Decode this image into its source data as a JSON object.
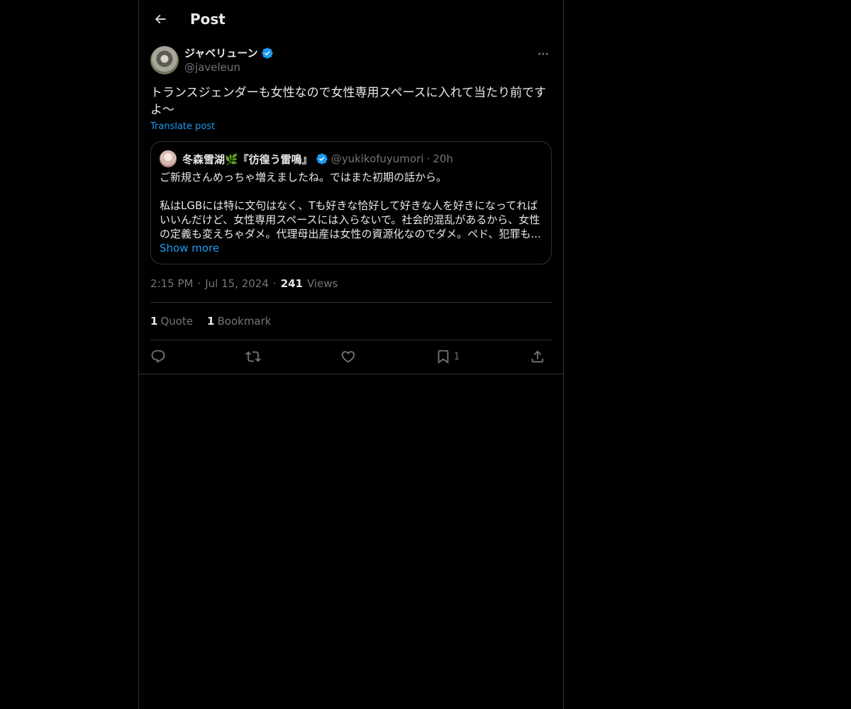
{
  "header": {
    "title": "Post"
  },
  "post": {
    "author_name": "ジャベリューン",
    "author_handle": "@javeleun",
    "verified": true,
    "text": "トランスジェンダーも女性なので女性専用スペースに入れて当たり前ですよ～",
    "translate_label": "Translate post",
    "time": "2:15 PM",
    "date": "Jul 15, 2024",
    "views_count": "241",
    "views_label": "Views",
    "separator": "·"
  },
  "quote": {
    "author_name": "冬森雪湖🌿『彷徨う雷鳴』",
    "author_handle": "@yukikofuyumori",
    "separator": "·",
    "time": "20h",
    "line1": "ご新規さんめっちゃ増えましたね。ではまた初期の話から。",
    "line2": "私はLGBには特に文句はなく、Tも好きな恰好して好きな人を好きになってれば",
    "line3": "いいんだけど、女性専用スペースには入らないで。社会的混乱があるから、女性",
    "line4": "の定義も変えちゃダメ。代理母出産は女性の資源化なのでダメ。ペド、犯罪も...",
    "show_more": "Show more"
  },
  "stats": {
    "quotes_count": "1",
    "quotes_label": "Quote",
    "bookmarks_count": "1",
    "bookmarks_label": "Bookmark"
  },
  "actions": {
    "bookmark_count": "1"
  },
  "colors": {
    "background": "#000000",
    "text": "#e7e9ea",
    "secondary": "#71767b",
    "accent": "#1d9bf0",
    "border": "#2f3336"
  },
  "icons": [
    "back-arrow-icon",
    "verified-badge-icon",
    "more-icon",
    "reply-icon",
    "repost-icon",
    "like-icon",
    "bookmark-icon",
    "share-icon"
  ]
}
